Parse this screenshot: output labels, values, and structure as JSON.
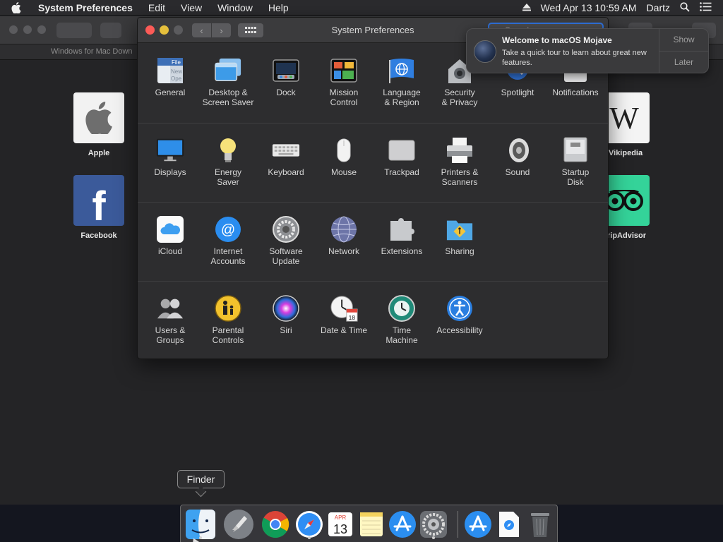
{
  "menubar": {
    "app_name": "System Preferences",
    "menus": [
      "Edit",
      "View",
      "Window",
      "Help"
    ],
    "datetime": "Wed Apr 13  10:59 AM",
    "user": "Dartz"
  },
  "browser": {
    "tab_title": "Windows for Mac Down",
    "favorites": [
      {
        "label": "Apple"
      },
      {
        "label": "Facebook"
      },
      {
        "label": "Vikipedia"
      },
      {
        "label": "ripAdvisor"
      }
    ]
  },
  "sysprefs": {
    "title": "System Preferences",
    "search_placeholder": "Search",
    "rows": [
      [
        {
          "label": "General",
          "icon": "general-icon"
        },
        {
          "label": "Desktop &\nScreen Saver",
          "icon": "desktop-screensaver-icon"
        },
        {
          "label": "Dock",
          "icon": "dock-icon"
        },
        {
          "label": "Mission\nControl",
          "icon": "mission-control-icon"
        },
        {
          "label": "Language\n& Region",
          "icon": "language-region-icon"
        },
        {
          "label": "Security\n& Privacy",
          "icon": "security-privacy-icon"
        },
        {
          "label": "Spotlight",
          "icon": "spotlight-icon"
        },
        {
          "label": "Notifications",
          "icon": "notifications-icon"
        }
      ],
      [
        {
          "label": "Displays",
          "icon": "displays-icon"
        },
        {
          "label": "Energy\nSaver",
          "icon": "energy-saver-icon"
        },
        {
          "label": "Keyboard",
          "icon": "keyboard-icon"
        },
        {
          "label": "Mouse",
          "icon": "mouse-icon"
        },
        {
          "label": "Trackpad",
          "icon": "trackpad-icon"
        },
        {
          "label": "Printers &\nScanners",
          "icon": "printers-scanners-icon"
        },
        {
          "label": "Sound",
          "icon": "sound-icon"
        },
        {
          "label": "Startup\nDisk",
          "icon": "startup-disk-icon"
        }
      ],
      [
        {
          "label": "iCloud",
          "icon": "icloud-icon"
        },
        {
          "label": "Internet\nAccounts",
          "icon": "internet-accounts-icon"
        },
        {
          "label": "Software\nUpdate",
          "icon": "software-update-icon"
        },
        {
          "label": "Network",
          "icon": "network-icon"
        },
        {
          "label": "Extensions",
          "icon": "extensions-icon"
        },
        {
          "label": "Sharing",
          "icon": "sharing-icon"
        }
      ],
      [
        {
          "label": "Users &\nGroups",
          "icon": "users-groups-icon"
        },
        {
          "label": "Parental\nControls",
          "icon": "parental-controls-icon"
        },
        {
          "label": "Siri",
          "icon": "siri-icon"
        },
        {
          "label": "Date & Time",
          "icon": "date-time-icon"
        },
        {
          "label": "Time\nMachine",
          "icon": "time-machine-icon"
        },
        {
          "label": "Accessibility",
          "icon": "accessibility-icon"
        }
      ]
    ]
  },
  "notification": {
    "title": "Welcome to macOS Mojave",
    "body": "Take a quick tour to learn about great new features.",
    "show_label": "Show",
    "later_label": "Later"
  },
  "dock": {
    "tooltip": "Finder",
    "calendar_month": "APR",
    "calendar_day": "13",
    "items": [
      {
        "name": "finder-icon"
      },
      {
        "name": "launchpad-icon"
      },
      {
        "name": "chrome-icon"
      },
      {
        "name": "safari-icon"
      },
      {
        "name": "calendar-icon"
      },
      {
        "name": "notes-icon"
      },
      {
        "name": "app-store-icon"
      },
      {
        "name": "system-preferences-icon"
      },
      {
        "name": "app-store-downloads-icon"
      },
      {
        "name": "downloads-stack-icon"
      },
      {
        "name": "trash-icon"
      }
    ]
  }
}
